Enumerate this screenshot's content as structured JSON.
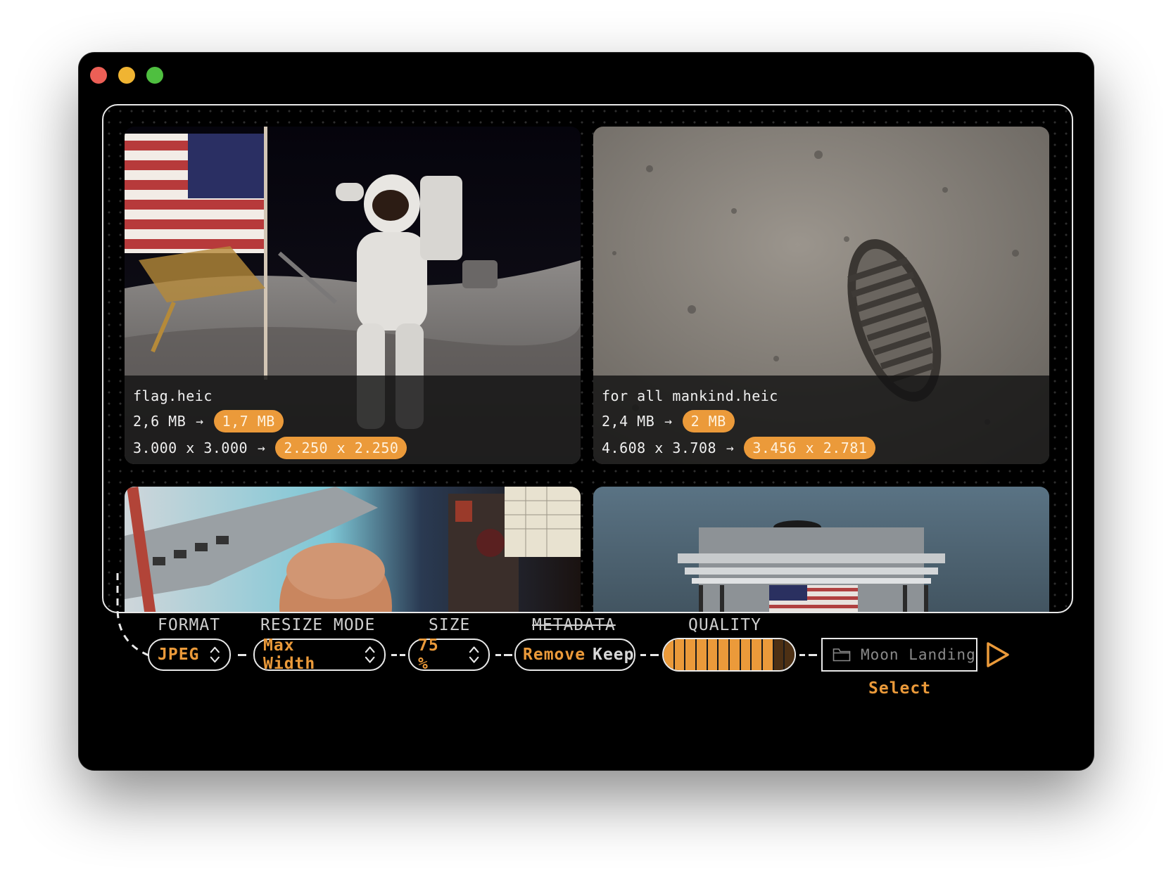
{
  "images": [
    {
      "filename": "flag.heic",
      "size_before": "2,6 MB",
      "size_after": "1,7 MB",
      "dims_before": "3.000 x 3.000",
      "dims_after": "2.250 x 2.250"
    },
    {
      "filename": "for all mankind.heic",
      "size_before": "2,4 MB",
      "size_after": "2 MB",
      "dims_before": "4.608 x 3.708",
      "dims_after": "3.456 x 2.781"
    }
  ],
  "arrow_glyph": "→",
  "labels": {
    "format": "FORMAT",
    "resize_mode": "RESIZE MODE",
    "size": "SIZE",
    "metadata": "METADATA",
    "quality": "QUALITY"
  },
  "controls": {
    "format": "JPEG",
    "resize_mode": "Max Width",
    "size": "75 %",
    "metadata_remove": "Remove",
    "metadata_keep": "Keep",
    "quality_level": 0.83,
    "output_folder_placeholder": "Moon Landing",
    "select_label": "Select"
  },
  "colors": {
    "accent": "#eb9a3a",
    "window_bg": "#000000",
    "traffic_red": "#ec5f56",
    "traffic_yellow": "#f0b432",
    "traffic_green": "#4fbf40"
  },
  "icons": [
    "stepper-icon",
    "folder-icon",
    "play-icon"
  ]
}
